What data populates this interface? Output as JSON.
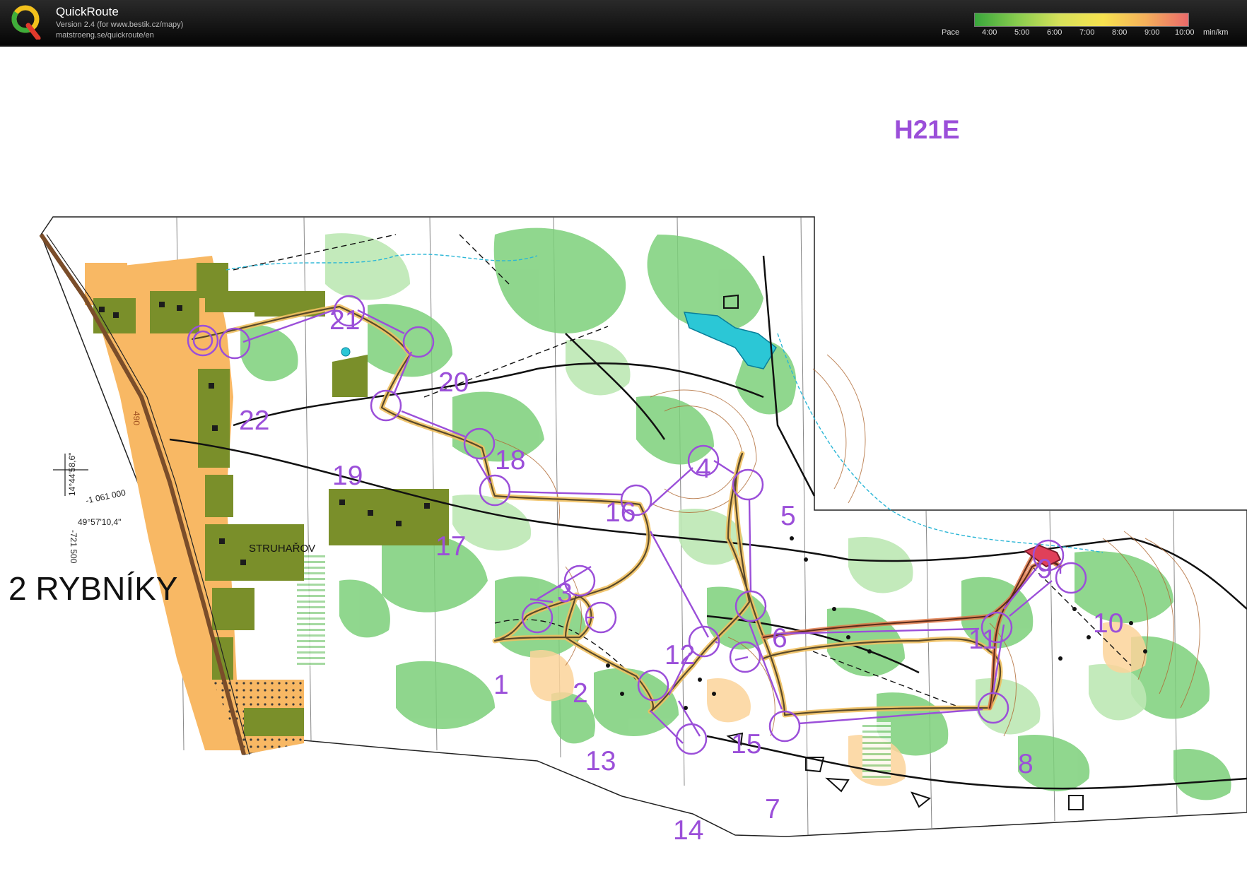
{
  "app": {
    "title": "QuickRoute",
    "version": "Version 2.4  (for www.bestik.cz/mapy)",
    "url": "matstroeng.se/quickroute/en"
  },
  "pace": {
    "label": "Pace",
    "ticks": [
      "4:00",
      "5:00",
      "6:00",
      "7:00",
      "8:00",
      "9:00",
      "10:00"
    ],
    "unit": "min/km",
    "colors": [
      "#39a63c",
      "#88cc4e",
      "#d7e15a",
      "#f7e24f",
      "#f5b05b",
      "#ea6a6a"
    ]
  },
  "map": {
    "class_title": "H21E",
    "map_name": "2 RYBNÍKY",
    "village": "STRUHAŘOV",
    "contour_label": "490",
    "coords": [
      "14°44'58,6\"",
      "-1 061 000",
      "49°57'10,4\"",
      "-721 500"
    ],
    "controls": [
      "1",
      "2",
      "3",
      "4",
      "5",
      "6",
      "7",
      "8",
      "9",
      "10",
      "11",
      "12",
      "13",
      "14",
      "15",
      "16",
      "17",
      "18",
      "19",
      "20",
      "21",
      "22"
    ],
    "course_color": "#9b4fd9"
  }
}
